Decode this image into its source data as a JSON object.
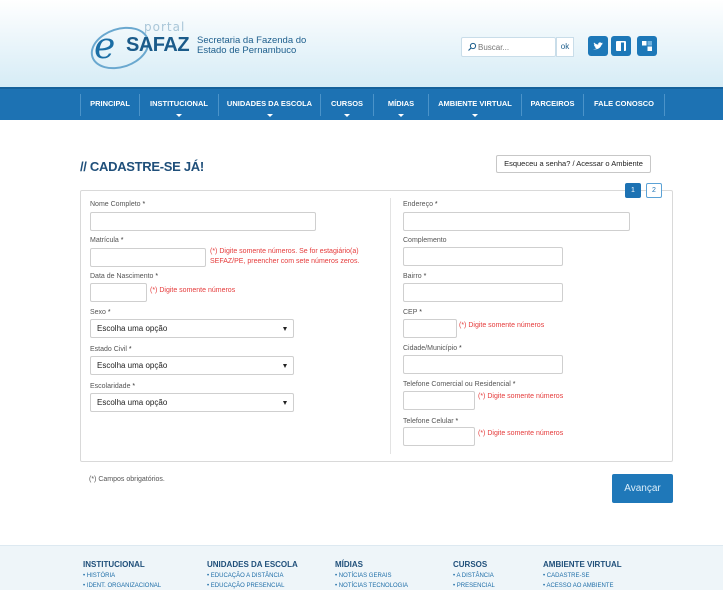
{
  "header": {
    "logo": {
      "portal": "portal",
      "brand": "SAFAZ",
      "letter": "e"
    },
    "org_line1": "Secretaria da Fazenda do",
    "org_line2": "Estado de Pernambuco",
    "search_placeholder": "Buscar...",
    "search_button": "ok",
    "social_icons": [
      "twitter-icon",
      "facebook-icon",
      "other-social-icon"
    ]
  },
  "nav": {
    "items": [
      {
        "label": "PRINCIPAL",
        "has_submenu": false
      },
      {
        "label": "INSTITUCIONAL",
        "has_submenu": true
      },
      {
        "label": "UNIDADES DA ESCOLA",
        "has_submenu": true
      },
      {
        "label": "CURSOS",
        "has_submenu": true
      },
      {
        "label": "MÍDIAS",
        "has_submenu": true
      },
      {
        "label": "AMBIENTE VIRTUAL",
        "has_submenu": true
      },
      {
        "label": "PARCEIROS",
        "has_submenu": false
      },
      {
        "label": "FALE CONOSCO",
        "has_submenu": false
      }
    ]
  },
  "page": {
    "title": "// CADASTRE-SE JÁ!",
    "forgot_button": "Esqueceu a senha? / Acessar o Ambiente",
    "steps": [
      "1",
      "2"
    ],
    "active_step": "1"
  },
  "form": {
    "left": {
      "nome": {
        "label": "Nome Completo",
        "req": "*"
      },
      "matricula": {
        "label": "Matrícula",
        "req": "*",
        "hint_line1": "(*) Digite somente números. Se for estagiário(a)",
        "hint_line2": "SEFAZ/PE, preencher com sete números zeros."
      },
      "nascimento": {
        "label": "Data de Nascimento",
        "req": "*",
        "hint": "(*) Digite somente números"
      },
      "sexo": {
        "label": "Sexo",
        "req": "*",
        "value": "Escolha uma opção"
      },
      "estado_civil": {
        "label": "Estado Civil",
        "req": "*",
        "value": "Escolha uma opção"
      },
      "escolaridade": {
        "label": "Escolaridade",
        "req": "*",
        "value": "Escolha uma opção"
      }
    },
    "right": {
      "endereco": {
        "label": "Endereço",
        "req": "*"
      },
      "complemento": {
        "label": "Complemento"
      },
      "bairro": {
        "label": "Bairro",
        "req": "*"
      },
      "cep": {
        "label": "CEP",
        "req": "*",
        "hint": "(*) Digite somente números"
      },
      "cidade": {
        "label": "Cidade/Município",
        "req": "*"
      },
      "tel_comercial": {
        "label": "Telefone Comercial ou Residencial",
        "req": "*",
        "hint": "(*) Digite somente números"
      },
      "tel_celular": {
        "label": "Telefone Celular",
        "req": "*",
        "hint": "(*) Digite somente números"
      }
    },
    "note": "(*) Campos obrigatórios.",
    "submit": "Avançar"
  },
  "footer": {
    "columns": [
      {
        "title": "INSTITUCIONAL",
        "items": [
          "HISTÓRIA",
          "IDENT. ORGANIZACIONAL"
        ]
      },
      {
        "title": "UNIDADES DA ESCOLA",
        "items": [
          "EDUCAÇÃO A DISTÂNCIA",
          "EDUCAÇÃO PRESENCIAL"
        ]
      },
      {
        "title": "MÍDIAS",
        "items": [
          "NOTÍCIAS GERAIS",
          "NOTÍCIAS TECNOLOGIA"
        ]
      },
      {
        "title": "CURSOS",
        "items": [
          "A DISTÂNCIA",
          "PRESENCIAL"
        ]
      },
      {
        "title": "AMBIENTE VIRTUAL",
        "items": [
          "CADASTRE-SE",
          "ACESSO AO AMBIENTE"
        ]
      }
    ]
  },
  "colors": {
    "primary": "#1d72b3",
    "title": "#1f4f7a",
    "hint": "#e53b3b"
  }
}
